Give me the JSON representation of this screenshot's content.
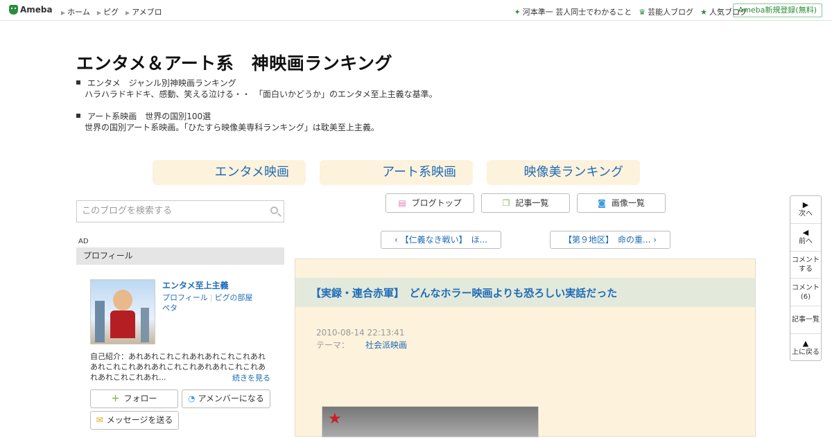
{
  "topbar": {
    "logo": "Ameba",
    "nav": [
      "ホーム",
      "ピグ",
      "アメブロ"
    ],
    "right_links": [
      "河本準一 芸人同士でわかること",
      "芸能人ブログ",
      "人気ブログ"
    ],
    "signup": "Ameba新規登録(無料)"
  },
  "blog": {
    "title": "エンタメ＆アート系　神映画ランキング",
    "desc": [
      {
        "head": "エンタメ　ジャンル別神映画ランキング",
        "sub": "ハラハラドキドキ、感動、笑える泣ける・・　「面白いかどうか」のエンタメ至上主義な基準。"
      },
      {
        "head": "アート系映画　世界の国別100選",
        "sub": "世界の国別アート系映画。「ひたすら映像美専科ランキング」は耽美至上主義。"
      }
    ],
    "categories": [
      "エンタメ映画",
      "アート系映画",
      "映像美ランキング"
    ]
  },
  "search": {
    "placeholder": "このブログを検索する"
  },
  "menu": {
    "top": "ブログトップ",
    "list": "記事一覧",
    "images": "画像一覧"
  },
  "ad": "AD",
  "profile": {
    "header": "プロフィール",
    "name": "エンタメ至上主義",
    "links": [
      "プロフィール",
      "ピグの部屋",
      "ペタ"
    ],
    "intro": "自己紹介：あれあれこれこれあれあれこれこれあれあれこれこれあれあれこれこれあれあれこれこれあれあれこれこれあれ...",
    "more": "続きを見る",
    "follow": "フォロー",
    "amember": "アメンバーになる",
    "message": "メッセージを送る"
  },
  "pager": {
    "prev": "【仁義なき戦い】　ほ...",
    "next": "【第９地区】　命の重..."
  },
  "article": {
    "title": "【実録・連合赤軍】　どんなホラー映画よりも恐ろしい実話だった",
    "date": "2010-08-14 22:13:41",
    "theme_label": "テーマ：",
    "theme": "社会派映画"
  },
  "side": {
    "next": "次へ",
    "prev": "前へ",
    "comment_post": "コメント\nする",
    "comment_label": "コメント",
    "comment_count": "(6)",
    "list": "記事一覧",
    "top": "上に戻る"
  }
}
